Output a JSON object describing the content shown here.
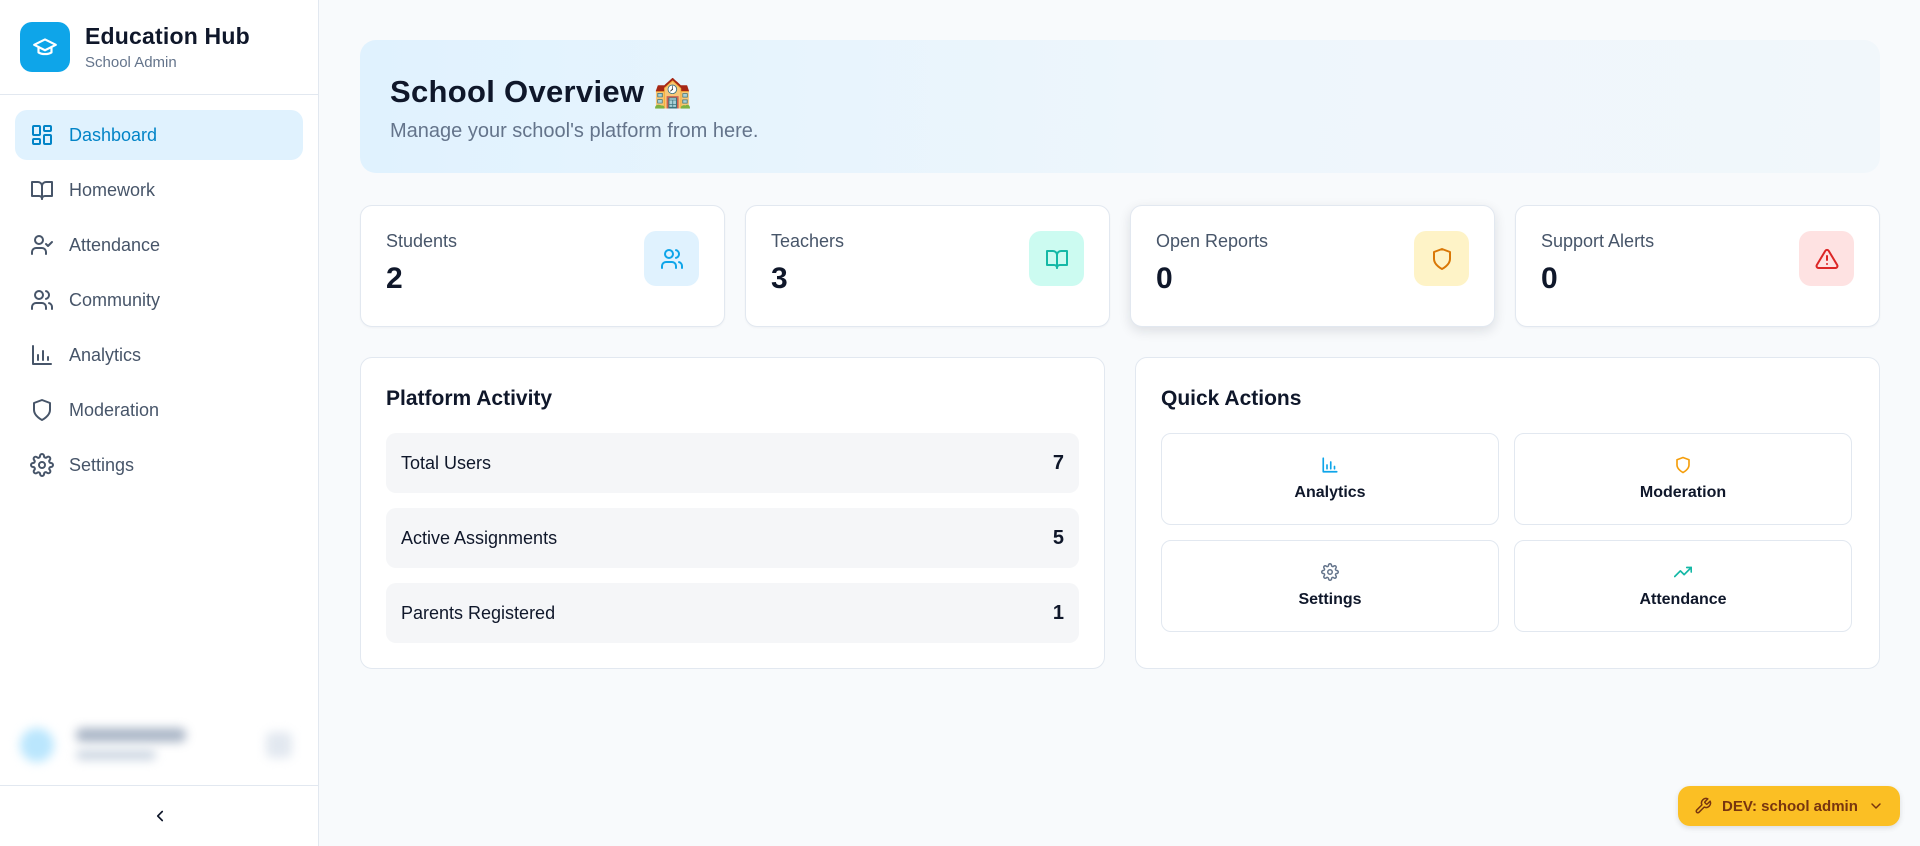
{
  "brand": {
    "title": "Education Hub",
    "subtitle": "School Admin",
    "logo_icon": "graduation-cap-icon"
  },
  "sidebar": {
    "items": [
      {
        "label": "Dashboard",
        "icon": "dashboard-icon",
        "active": true
      },
      {
        "label": "Homework",
        "icon": "book-icon"
      },
      {
        "label": "Attendance",
        "icon": "user-check-icon"
      },
      {
        "label": "Community",
        "icon": "users-icon"
      },
      {
        "label": "Analytics",
        "icon": "bar-chart-icon"
      },
      {
        "label": "Moderation",
        "icon": "shield-icon"
      },
      {
        "label": "Settings",
        "icon": "gear-icon"
      }
    ],
    "collapse_icon": "chevron-left-icon"
  },
  "hero": {
    "title": "School Overview 🏫",
    "subtitle": "Manage your school's platform from here."
  },
  "stats": [
    {
      "label": "Students",
      "value": "2",
      "icon": "users-icon",
      "color": "#0ea5e9"
    },
    {
      "label": "Teachers",
      "value": "3",
      "icon": "book-icon",
      "color": "#14b8a6"
    },
    {
      "label": "Open Reports",
      "value": "0",
      "icon": "shield-icon",
      "color": "#d97706"
    },
    {
      "label": "Support Alerts",
      "value": "0",
      "icon": "alert-triangle-icon",
      "color": "#dc2626"
    }
  ],
  "activity": {
    "title": "Platform Activity",
    "rows": [
      {
        "label": "Total Users",
        "value": "7"
      },
      {
        "label": "Active Assignments",
        "value": "5"
      },
      {
        "label": "Parents Registered",
        "value": "1"
      }
    ]
  },
  "quick_actions": {
    "title": "Quick Actions",
    "items": [
      {
        "label": "Analytics",
        "icon": "bar-chart-icon",
        "color": "#0ea5e9"
      },
      {
        "label": "Moderation",
        "icon": "shield-icon",
        "color": "#f59e0b"
      },
      {
        "label": "Settings",
        "icon": "gear-icon",
        "color": "#64748b"
      },
      {
        "label": "Attendance",
        "icon": "trending-up-icon",
        "color": "#14b8a6"
      }
    ]
  },
  "dev_badge": {
    "label": "DEV: school admin",
    "icon": "wrench-icon",
    "color": "#fbbf24"
  }
}
